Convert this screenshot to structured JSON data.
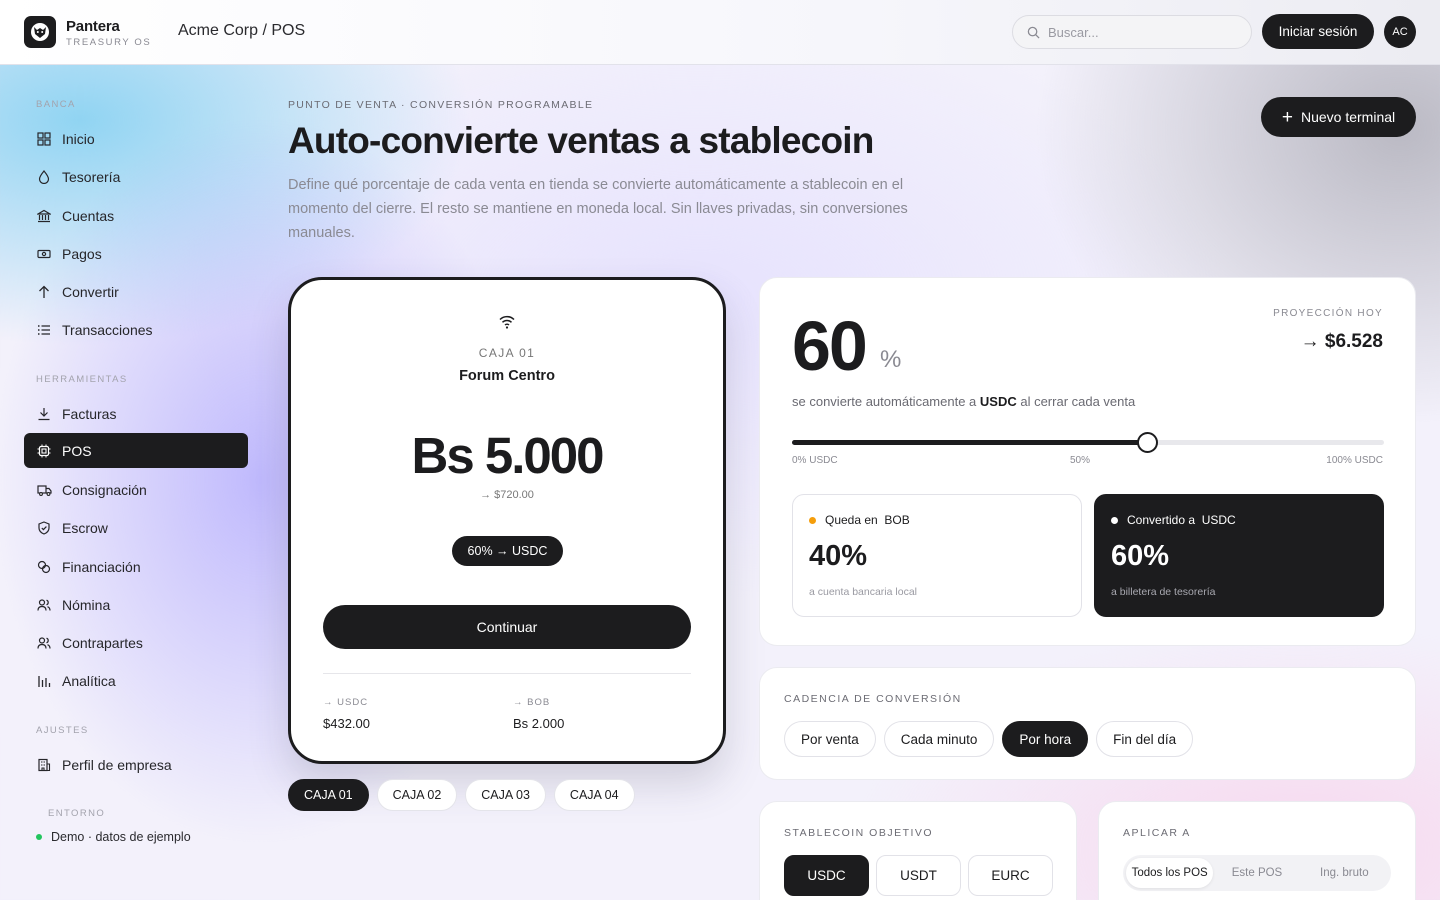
{
  "brand": {
    "name": "Pantera",
    "subtitle": "TREASURY OS"
  },
  "org_path": "Acme Corp / POS",
  "search": {
    "placeholder": "Buscar..."
  },
  "header": {
    "login_label": "Iniciar sesión",
    "avatar_initials": "AC"
  },
  "sidebar": {
    "section_banca": "BANCA",
    "banca": [
      {
        "label": "Inicio",
        "icon": "grid-icon"
      },
      {
        "label": "Tesorería",
        "icon": "drop-icon"
      },
      {
        "label": "Cuentas",
        "icon": "bank-icon"
      },
      {
        "label": "Pagos",
        "icon": "banknote-icon"
      },
      {
        "label": "Convertir",
        "icon": "arrow-up-icon"
      },
      {
        "label": "Transacciones",
        "icon": "list-icon"
      }
    ],
    "section_herramientas": "HERRAMIENTAS",
    "herramientas": [
      {
        "label": "Facturas",
        "icon": "download-icon"
      },
      {
        "label": "POS",
        "icon": "chip-icon",
        "active": true
      },
      {
        "label": "Consignación",
        "icon": "truck-icon"
      },
      {
        "label": "Escrow",
        "icon": "shield-icon"
      },
      {
        "label": "Financiación",
        "icon": "coins-icon"
      },
      {
        "label": "Nómina",
        "icon": "users-icon"
      },
      {
        "label": "Contrapartes",
        "icon": "users-icon"
      },
      {
        "label": "Analítica",
        "icon": "bars-icon"
      }
    ],
    "section_ajustes": "AJUSTES",
    "ajustes": [
      {
        "label": "Perfil de empresa",
        "icon": "building-icon"
      }
    ],
    "env_label": "ENTORNO",
    "env_value": "Demo · datos de ejemplo"
  },
  "page": {
    "eyebrow": "PUNTO DE VENTA · CONVERSIÓN PROGRAMABLE",
    "title": "Auto-convierte ventas a stablecoin",
    "description": "Define qué porcentaje de cada venta en tienda se convierte automáticamente a stablecoin en el momento del cierre. El resto se mantiene en moneda local. Sin llaves privadas, sin conversiones manuales.",
    "new_terminal_label": "Nuevo terminal"
  },
  "device": {
    "caja": "CAJA 01",
    "store": "Forum Centro",
    "amount": "Bs 5.000",
    "converted": "→ $720.00",
    "pill": "60% → USDC",
    "continue_label": "Continuar",
    "usdc_label": "→ USDC",
    "usdc_value": "$432.00",
    "bob_label": "→ BOB",
    "bob_value": "Bs 2.000"
  },
  "caja_tabs": [
    {
      "label": "CAJA 01",
      "active": true
    },
    {
      "label": "CAJA 02",
      "active": false
    },
    {
      "label": "CAJA 03",
      "active": false
    },
    {
      "label": "CAJA 04",
      "active": false
    }
  ],
  "conversion": {
    "percent": "60",
    "percent_symbol": "%",
    "desc_before": "se convierte automáticamente a ",
    "desc_coin": "USDC",
    "desc_after": " al cerrar cada venta",
    "projection_label": "PROYECCIÓN HOY",
    "projection_value": "→ $6.528",
    "slider_value": 0.6,
    "slider_min_label": "0% USDC",
    "slider_mid_label": "50%",
    "slider_max_label": "100% USDC",
    "remain": {
      "label": "Queda en",
      "currency": "BOB",
      "pct": "40%",
      "sub": "a cuenta bancaria local",
      "dot_color": "#f59e0b"
    },
    "converted": {
      "label": "Convertido a",
      "currency": "USDC",
      "pct": "60%",
      "sub": "a billetera de tesorería",
      "dot_color": "#ffffff"
    }
  },
  "cadence": {
    "label": "CADENCIA DE CONVERSIÓN",
    "options": [
      {
        "label": "Por venta",
        "active": false
      },
      {
        "label": "Cada minuto",
        "active": false
      },
      {
        "label": "Por hora",
        "active": true
      },
      {
        "label": "Fin del día",
        "active": false
      }
    ]
  },
  "stablecoin": {
    "label": "STABLECOIN OBJETIVO",
    "options": [
      {
        "label": "USDC",
        "active": true
      },
      {
        "label": "USDT",
        "active": false
      },
      {
        "label": "EURC",
        "active": false
      }
    ]
  },
  "apply_to": {
    "label": "APLICAR A",
    "options": [
      {
        "label": "Todos los POS",
        "active": true
      },
      {
        "label": "Este POS",
        "active": false
      },
      {
        "label": "Ing. bruto",
        "active": false
      }
    ]
  }
}
